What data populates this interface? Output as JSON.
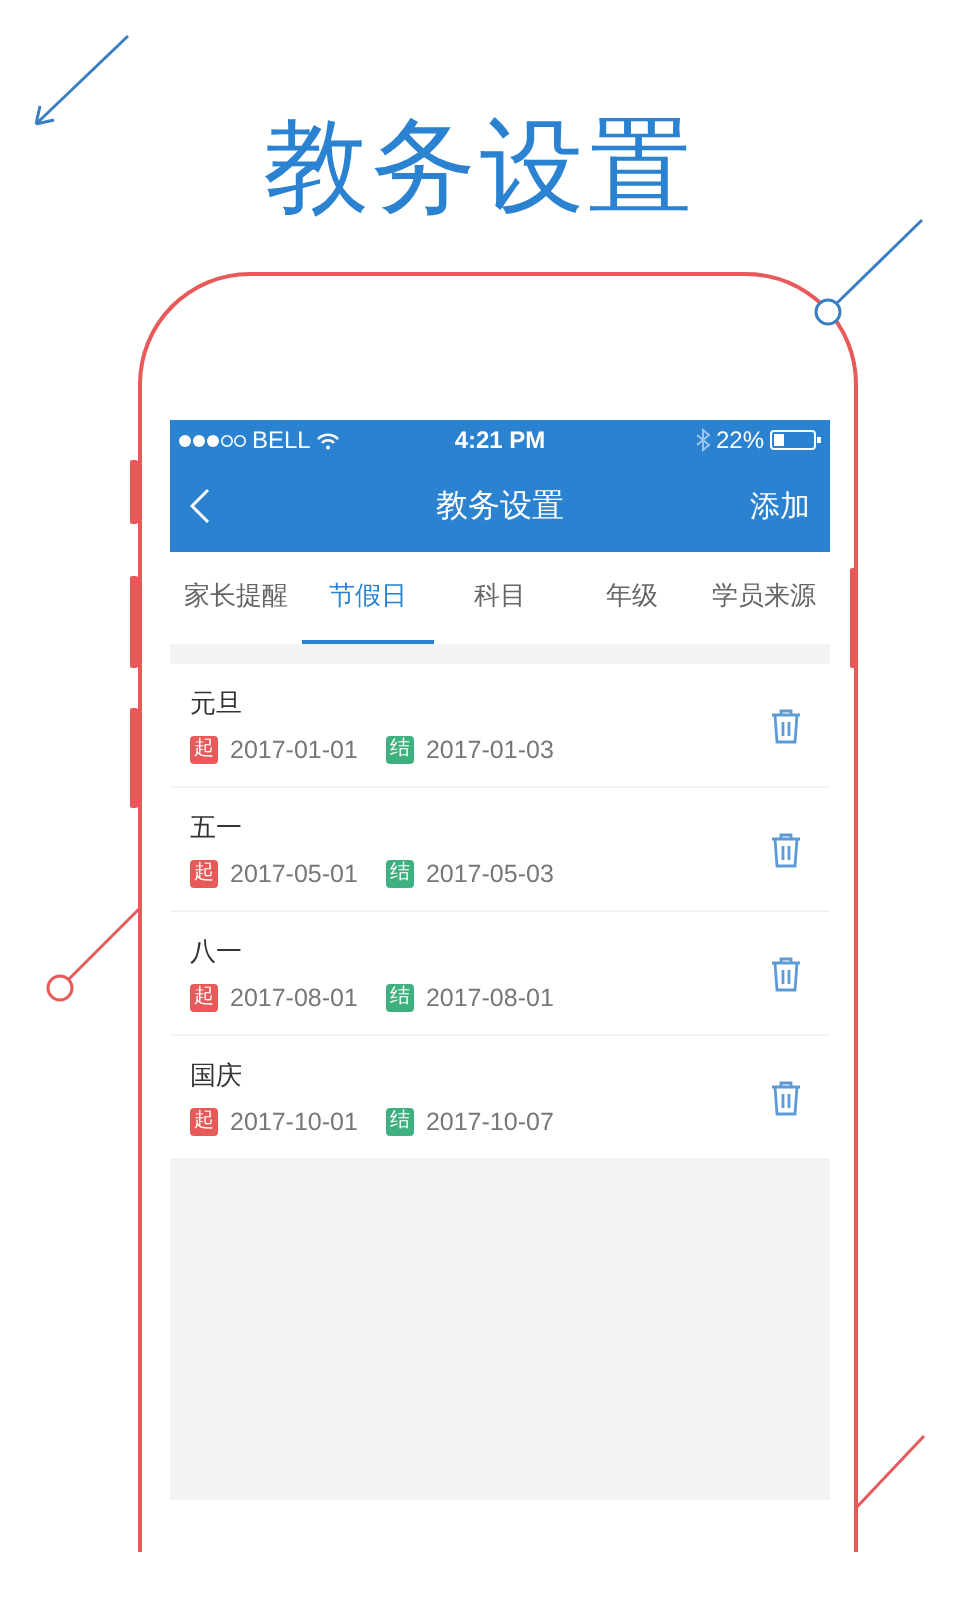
{
  "headline": "教务设置",
  "status_bar": {
    "carrier": "BELL",
    "time": "4:21 PM",
    "battery": "22%"
  },
  "nav": {
    "title": "教务设置",
    "action": "添加"
  },
  "tabs": [
    {
      "label": "家长提醒",
      "selected": false
    },
    {
      "label": "节假日",
      "selected": true
    },
    {
      "label": "科目",
      "selected": false
    },
    {
      "label": "年级",
      "selected": false
    },
    {
      "label": "学员来源",
      "selected": false
    }
  ],
  "holidays": [
    {
      "name": "元旦",
      "start_tag": "起",
      "start": "2017-01-01",
      "end_tag": "结",
      "end": "2017-01-03"
    },
    {
      "name": "五一",
      "start_tag": "起",
      "start": "2017-05-01",
      "end_tag": "结",
      "end": "2017-05-03"
    },
    {
      "name": "八一",
      "start_tag": "起",
      "start": "2017-08-01",
      "end_tag": "结",
      "end": "2017-08-01"
    },
    {
      "name": "国庆",
      "start_tag": "起",
      "start": "2017-10-01",
      "end_tag": "结",
      "end": "2017-10-07"
    }
  ]
}
